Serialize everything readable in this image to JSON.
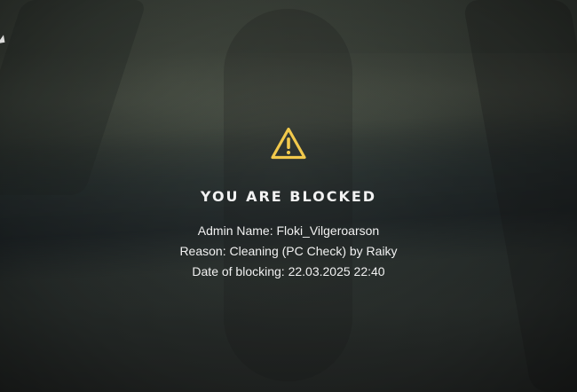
{
  "colors": {
    "warning": "#f2c94c",
    "text": "#f2f2f2"
  },
  "icons": {
    "warning": "warning-triangle-icon",
    "cursor": "mouse-pointer-icon"
  },
  "notice": {
    "title": "YOU ARE BLOCKED",
    "lines": [
      {
        "label": "Admin Name: ",
        "value": "Floki_Vilgeroarson"
      },
      {
        "label": "Reason: ",
        "value": "Cleaning (PC Check) by Raiky"
      },
      {
        "label": "Date of blocking: ",
        "value": "22.03.2025 22:40"
      }
    ]
  }
}
